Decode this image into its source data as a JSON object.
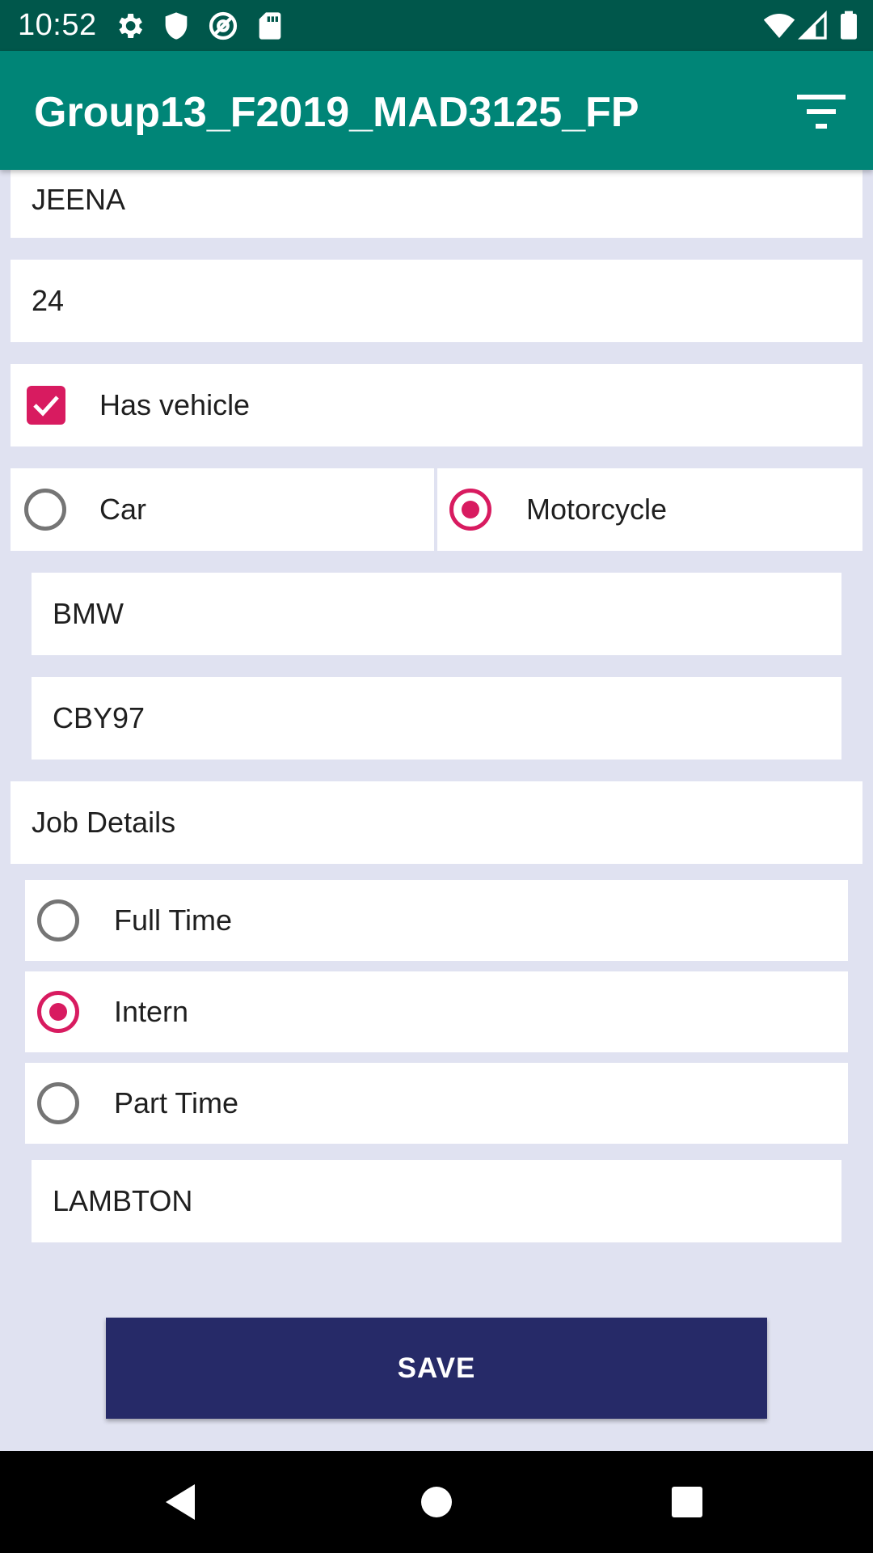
{
  "status_bar": {
    "time": "10:52",
    "icons": [
      "gear-icon",
      "shield-icon",
      "at-sign-icon",
      "sd-card-icon",
      "wifi-icon",
      "signal-icon",
      "battery-icon"
    ]
  },
  "app_bar": {
    "title": "Group13_F2019_MAD3125_FP",
    "action_icon": "filter-icon"
  },
  "form": {
    "name_value": "JEENA",
    "age_value": "24",
    "has_vehicle": {
      "label": "Has vehicle",
      "checked": true
    },
    "vehicle_type": {
      "options": [
        {
          "label": "Car",
          "selected": false
        },
        {
          "label": "Motorcycle",
          "selected": true
        }
      ]
    },
    "vehicle_make_value": "BMW",
    "plate_value": "CBY97",
    "job_details_label": "Job Details",
    "job_type": {
      "options": [
        {
          "label": "Full Time",
          "selected": false
        },
        {
          "label": "Intern",
          "selected": true
        },
        {
          "label": "Part Time",
          "selected": false
        }
      ]
    },
    "school_value": "LAMBTON"
  },
  "save_label": "SAVE",
  "colors": {
    "status_bar": "#00574b",
    "app_bar": "#008577",
    "accent": "#d81b60",
    "save_button": "#262a68",
    "background": "#e0e2f1"
  },
  "nav_bar": {
    "icons": [
      "back-icon",
      "home-icon",
      "recents-icon"
    ]
  }
}
